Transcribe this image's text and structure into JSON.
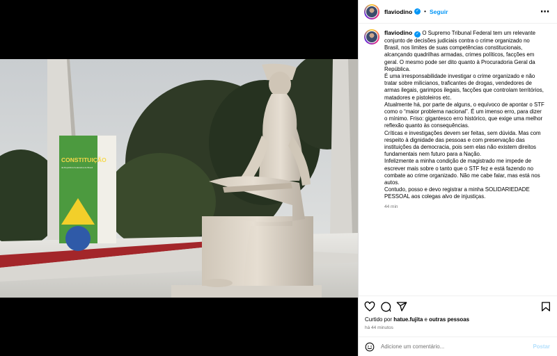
{
  "post": {
    "username": "flaviodino",
    "follow_label": "Seguir",
    "dot": "•",
    "caption_lines": [
      "O Supremo Tribunal Federal tem um relevante",
      "conjunto de decisões judiciais contra o crime organizado no",
      "Brasil, nos limites de suas competências constitucionais,",
      "alcançando quadrilhas armadas, crimes políticos, facções em",
      "geral. O mesmo pode ser dito quanto à Procuradoria Geral da",
      "República.",
      "É uma irresponsabilidade investigar o crime organizado e não",
      "tratar sobre milicianos, traficantes de drogas, vendedores de",
      "armas ilegais, garimpos ilegais, facções que controlam territórios,",
      "matadores e pistoleiros etc.",
      "Atualmente há, por parte de alguns, o equívoco de apontar o STF",
      "como o “maior problema nacional”. É um imenso erro, para dizer",
      "o mínimo. Friso: gigantesco erro histórico, que exige uma melhor",
      "reflexão quanto às consequências.",
      "Críticas e investigações devem ser feitas, sem dúvida. Mas com",
      "respeito à dignidade das pessoas e com preservação das",
      "instituições da democracia, pois sem elas não existem direitos",
      "fundamentais nem futuro para a Nação.",
      "Infelizmente a minha condição de magistrado me impede de",
      "escrever mais sobre o tanto que o STF fez e está fazendo no",
      "combate ao crime organizado. Não me cabe falar, mas está nos",
      "autos.",
      "Contudo, posso e devo registrar a minha SOLIDARIEDADE",
      "PESSOAL aos colegas alvo de injustiças."
    ],
    "caption_time": "44 min",
    "likes_prefix": "Curtido por",
    "likes_user": "hatue.fujita",
    "likes_and": "e",
    "likes_others": "outras pessoas",
    "posted_ago": "há 44 minutos",
    "comment_placeholder": "Adicione um comentário...",
    "post_label": "Postar"
  },
  "photo": {
    "book_title": "CONSTITUIÇÃO",
    "book_subtitle": "da República Federativa do Brasil"
  },
  "icons": {
    "more": "more-options-icon",
    "verified": "verified-badge-icon",
    "like": "heart-icon",
    "comment": "comment-icon",
    "share": "share-icon",
    "save": "bookmark-icon",
    "emoji": "emoji-icon"
  },
  "colors": {
    "accent": "#0095f6",
    "post_disabled": "#b2dffc",
    "muted": "#737373"
  }
}
